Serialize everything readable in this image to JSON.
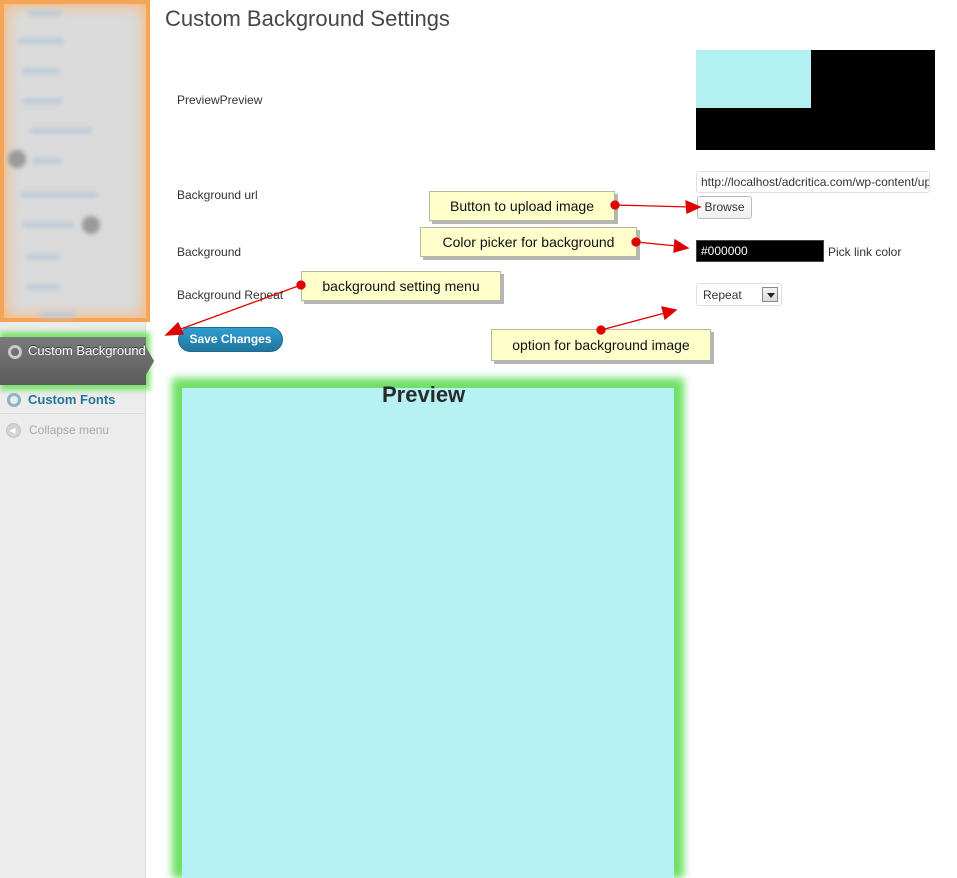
{
  "page": {
    "title": "Custom Background Settings"
  },
  "sidebar": {
    "active_item": "Custom Background",
    "custom_fonts": "Custom Fonts",
    "collapse": "Collapse menu",
    "collapse_glyph": "◀"
  },
  "form": {
    "preview_label": "PreviewPreview",
    "background_url_label": "Background url",
    "background_url_value": "http://localhost/adcritica.com/wp-content/uploads/",
    "browse_button": "Browse",
    "background_label": "Background",
    "color_value": "#000000",
    "pick_link_color": "Pick link color",
    "background_repeat_label": "Background Repeat",
    "repeat_selected": "Repeat",
    "save_button": "Save Changes"
  },
  "preview": {
    "heading": "Preview"
  },
  "callouts": {
    "upload": "Button to upload image",
    "color_picker": "Color picker for background",
    "setting_menu": "background setting menu",
    "bg_option": "option for background image"
  },
  "colors": {
    "preview_bg": "#b6f1f3",
    "swatch_bg": "#000000",
    "highlight_green": "#6fe065",
    "highlight_orange": "#f6a456",
    "callout_bg": "#ffffcc",
    "arrow_red": "#e00000",
    "link_blue": "#21759b"
  },
  "icons": {
    "menu_gear": "gear-icon",
    "fonts_gear": "gear-icon",
    "collapse": "collapse-arrow-icon",
    "select_dropdown": "chevron-down-icon"
  }
}
